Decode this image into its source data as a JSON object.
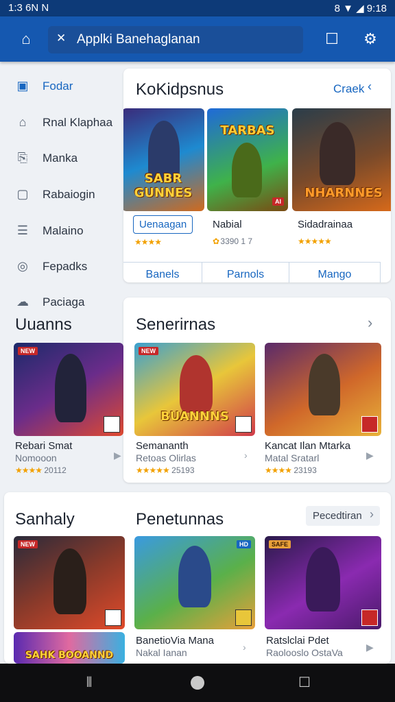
{
  "status": {
    "time_left": "1:3 6N  N",
    "time_right": "8 ▼ ◢ 9:18"
  },
  "appbar": {
    "search_text": "Applki Banehaglanan"
  },
  "sidebar": {
    "items": [
      {
        "label": "Fodar",
        "icon": "square-icon"
      },
      {
        "label": "Rnal Klaphaa",
        "icon": "hanger-icon"
      },
      {
        "label": "Manka",
        "icon": "bookmark-icon"
      },
      {
        "label": "Rabaiogin",
        "icon": "doc-icon"
      },
      {
        "label": "Malaino",
        "icon": "list-icon"
      },
      {
        "label": "Fepadks",
        "icon": "circle-icon"
      },
      {
        "label": "Paciaga",
        "icon": "cloud-icon"
      }
    ]
  },
  "featured": {
    "title": "KoKidpsnus",
    "link": "Craek",
    "games": [
      {
        "logo": "SABR GUNNES",
        "pill": "Uenaagan",
        "rating": "★★★★"
      },
      {
        "logo": "TARBAS",
        "name": "Nabial",
        "rating_text": "3390 1 7"
      },
      {
        "logo": "NHARNNES",
        "name": "Sidadrainaa",
        "rating": "★★★★★"
      }
    ],
    "tabs": [
      "Banels",
      "Parnols",
      "Mango"
    ]
  },
  "left_heading": "Uuanns",
  "series": {
    "title": "Senerirnas",
    "left_game": {
      "name": "Rebari Smat",
      "sub": "Nomooon",
      "rating": "★★★★",
      "count": "20112"
    },
    "games": [
      {
        "name": "Semananth",
        "sub": "Retoas Olirlas",
        "rating": "★★★★★",
        "count": "25193",
        "logo": "BUANNNS"
      },
      {
        "name": "Kancat Ilan Mtarka",
        "sub": "Matal Sratarl",
        "rating": "★★★★",
        "count": "23193"
      }
    ]
  },
  "bottom": {
    "left_title": "Sanhaly",
    "title": "Penetunnas",
    "button": "Pecedtiran",
    "left_logo": "SAHK BOOANND",
    "games": [
      {
        "name": "BanetioVia Mana",
        "sub": "Nakal Ianan"
      },
      {
        "name": "Ratslclai Pdet",
        "sub": "Raolooslo OstaVa"
      }
    ]
  },
  "colors": {
    "accent": "#1766c0",
    "appbar": "#1558b0",
    "status": "#0d3a78"
  }
}
